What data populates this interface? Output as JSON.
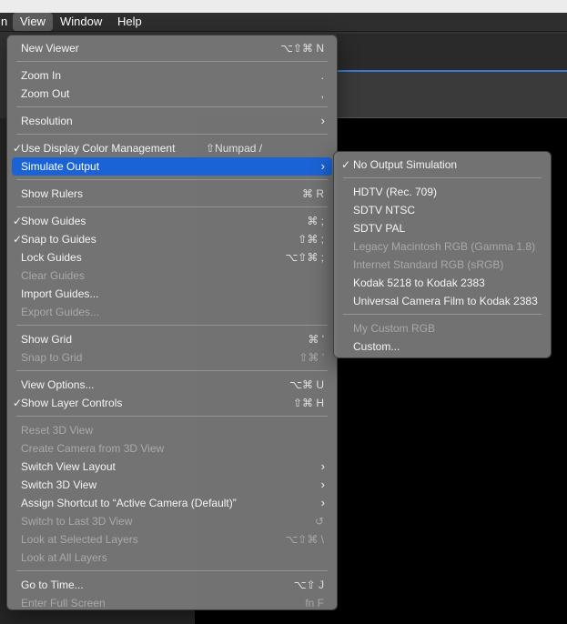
{
  "menubar": {
    "items": [
      {
        "label": "n",
        "active": false
      },
      {
        "label": "View",
        "active": true
      },
      {
        "label": "Window",
        "active": false
      },
      {
        "label": "Help",
        "active": false
      }
    ]
  },
  "view_menu": {
    "new_viewer": {
      "label": "New Viewer",
      "shortcut": "⌥⇧⌘ N"
    },
    "zoom_in": {
      "label": "Zoom In",
      "shortcut": "."
    },
    "zoom_out": {
      "label": "Zoom Out",
      "shortcut": ","
    },
    "resolution": {
      "label": "Resolution"
    },
    "use_display_color_management": {
      "label": "Use Display Color Management",
      "shortcut": "⇧Numpad /",
      "checked": true
    },
    "simulate_output": {
      "label": "Simulate Output"
    },
    "show_rulers": {
      "label": "Show Rulers",
      "shortcut": "⌘ R"
    },
    "show_guides": {
      "label": "Show Guides",
      "shortcut": "⌘ ;",
      "checked": true
    },
    "snap_to_guides": {
      "label": "Snap to Guides",
      "shortcut": "⇧⌘ ;",
      "checked": true
    },
    "lock_guides": {
      "label": "Lock Guides",
      "shortcut": "⌥⇧⌘ ;"
    },
    "clear_guides": {
      "label": "Clear Guides"
    },
    "import_guides": {
      "label": "Import Guides..."
    },
    "export_guides": {
      "label": "Export Guides..."
    },
    "show_grid": {
      "label": "Show Grid",
      "shortcut": "⌘ '"
    },
    "snap_to_grid": {
      "label": "Snap to Grid",
      "shortcut": "⇧⌘ '"
    },
    "view_options": {
      "label": "View Options...",
      "shortcut": "⌥⌘ U"
    },
    "show_layer_controls": {
      "label": "Show Layer Controls",
      "shortcut": "⇧⌘ H",
      "checked": true
    },
    "reset_3d_view": {
      "label": "Reset 3D View"
    },
    "create_camera": {
      "label": "Create Camera from 3D View"
    },
    "switch_view_layout": {
      "label": "Switch View Layout"
    },
    "switch_3d_view": {
      "label": "Switch 3D View"
    },
    "assign_shortcut": {
      "label": "Assign Shortcut to “Active Camera (Default)”"
    },
    "switch_to_last_3d": {
      "label": "Switch to Last 3D View",
      "shortcut": "↺"
    },
    "look_at_selected": {
      "label": "Look at Selected Layers",
      "shortcut": "⌥⇧⌘ \\"
    },
    "look_at_all": {
      "label": "Look at All Layers"
    },
    "go_to_time": {
      "label": "Go to Time...",
      "shortcut": "⌥⇧ J"
    },
    "enter_full_screen": {
      "label": "Enter Full Screen",
      "shortcut": "fn F"
    }
  },
  "simulate_output_menu": {
    "no_output_simulation": {
      "label": "No Output Simulation",
      "checked": true
    },
    "hdtv": {
      "label": "HDTV (Rec. 709)"
    },
    "sdtv_ntsc": {
      "label": "SDTV NTSC"
    },
    "sdtv_pal": {
      "label": "SDTV PAL"
    },
    "legacy_mac_rgb": {
      "label": "Legacy Macintosh RGB (Gamma 1.8)"
    },
    "internet_standard_rgb": {
      "label": "Internet Standard RGB (sRGB)"
    },
    "kodak_5218": {
      "label": "Kodak 5218 to Kodak 2383"
    },
    "universal_camera_film": {
      "label": "Universal Camera Film to Kodak 2383"
    },
    "my_custom_rgb": {
      "label": "My Custom RGB"
    },
    "custom": {
      "label": "Custom..."
    }
  },
  "symbols": {
    "check": "✓",
    "arrow": "›"
  },
  "colors": {
    "highlight": "#1a63d6",
    "menu_bg": "#767676",
    "accent_line": "#3a7bd5"
  }
}
